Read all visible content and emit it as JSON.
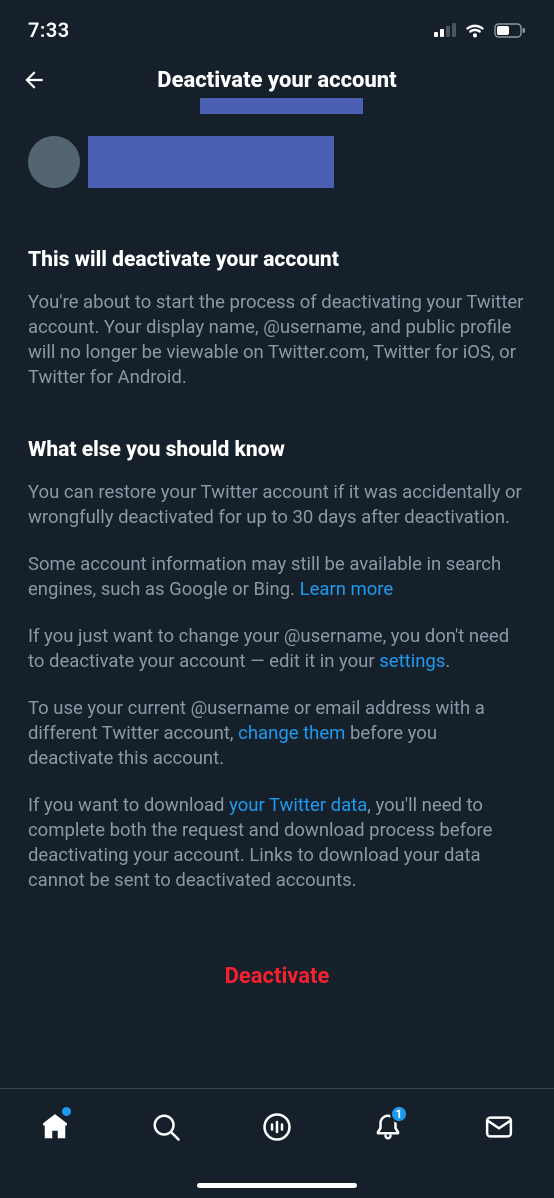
{
  "status": {
    "time": "7:33"
  },
  "header": {
    "title": "Deactivate your account"
  },
  "section1": {
    "heading": "This will deactivate your account",
    "body": "You're about to start the process of deactivating your Twitter account. Your display name, @username, and public profile will no longer be viewable on Twitter.com, Twitter for iOS, or Twitter for Android."
  },
  "section2": {
    "heading": "What else you should know",
    "p1": "You can restore your Twitter account if it was accidentally or wrongfully deactivated for up to 30 days after deactivation.",
    "p2a": "Some account information may still be available in search engines, such as Google or Bing. ",
    "p2link": "Learn more",
    "p3a": "If you just want to change your @username, you don't need to deactivate your account — edit it in your ",
    "p3link": "settings",
    "p3b": ".",
    "p4a": "To use your current @username or email address with a different Twitter account, ",
    "p4link": "change them",
    "p4b": " before you deactivate this account.",
    "p5a": "If you want to download ",
    "p5link": "your Twitter data",
    "p5b": ", you'll need to complete both the request and download process before deactivating your account. Links to download your data cannot be sent to deactivated accounts."
  },
  "deactivate": {
    "label": "Deactivate"
  },
  "notifications": {
    "count": "1"
  }
}
